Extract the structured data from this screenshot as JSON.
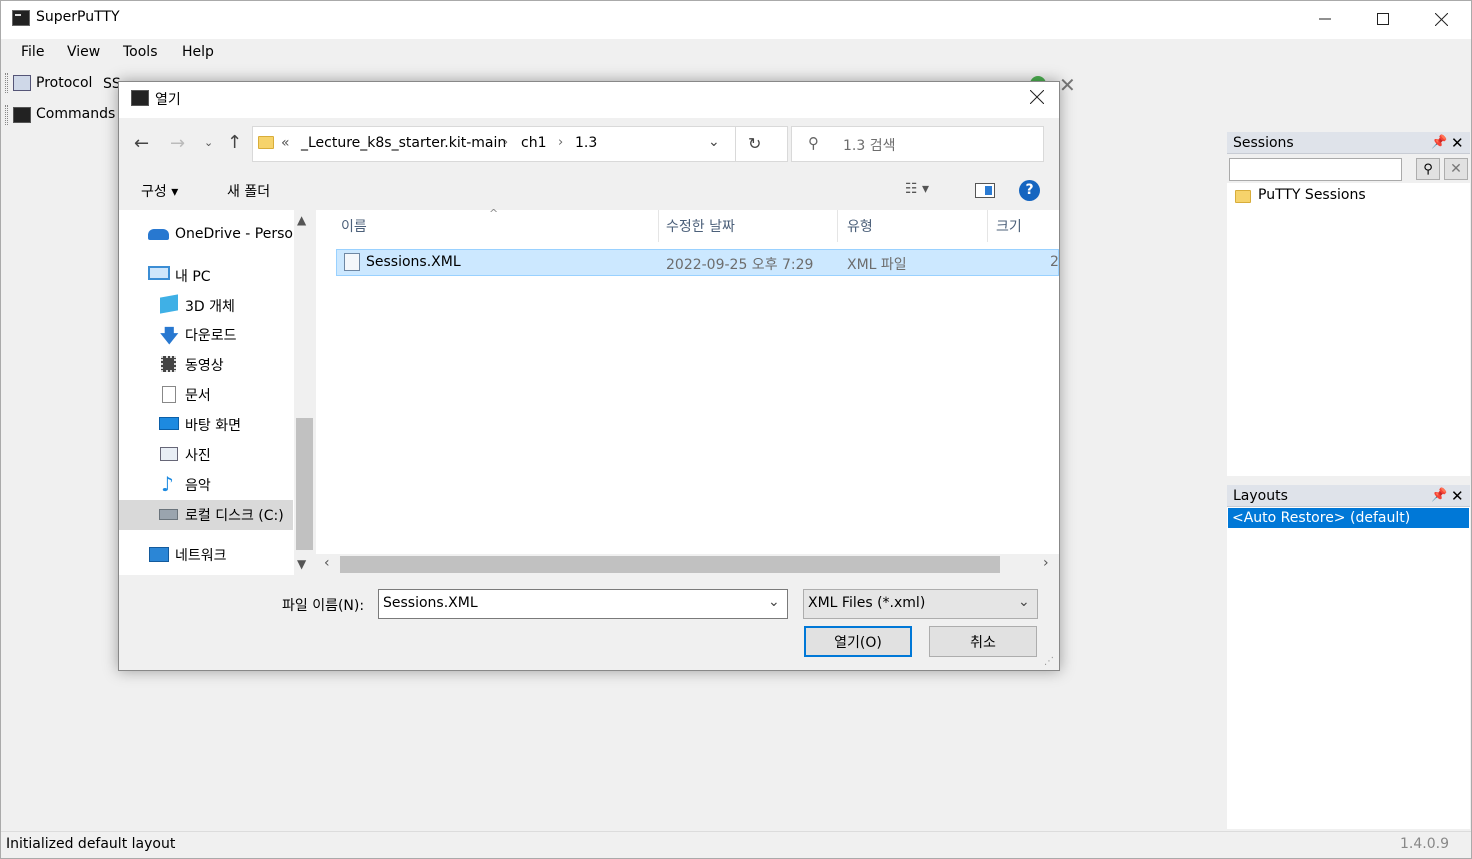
{
  "window": {
    "title": "SuperPuTTY"
  },
  "menu": [
    "File",
    "View",
    "Tools",
    "Help"
  ],
  "toolbar": {
    "protocol_label": "Protocol",
    "protocol_value": "SSH",
    "commands_label": "Commands"
  },
  "sessions_panel": {
    "title": "Sessions",
    "tree_root": "PuTTY Sessions"
  },
  "layouts_panel": {
    "title": "Layouts",
    "items": [
      "<Auto Restore> (default)"
    ]
  },
  "status": {
    "message": "Initialized default layout",
    "version": "1.4.0.9"
  },
  "dialog": {
    "title": "열기",
    "breadcrumb": [
      "«",
      "_Lecture_k8s_starter.kit-main",
      "ch1",
      "1.3"
    ],
    "search_placeholder": "1.3 검색",
    "organize_label": "구성 ▾",
    "new_folder_label": "새 폴더",
    "nav": [
      "OneDrive - Personal",
      "내 PC",
      "3D 개체",
      "다운로드",
      "동영상",
      "문서",
      "바탕 화면",
      "사진",
      "음악",
      "로컬 디스크 (C:)",
      "네트워크"
    ],
    "columns": [
      "이름",
      "수정한 날짜",
      "유형",
      "크기"
    ],
    "files": [
      {
        "name": "Sessions.XML",
        "modified": "2022-09-25 오후 7:29",
        "type": "XML 파일",
        "size": "2"
      }
    ],
    "filename_label": "파일 이름(N):",
    "filename_value": "Sessions.XML",
    "filetype_value": "XML Files (*.xml)",
    "open_label": "열기(O)",
    "cancel_label": "취소"
  }
}
